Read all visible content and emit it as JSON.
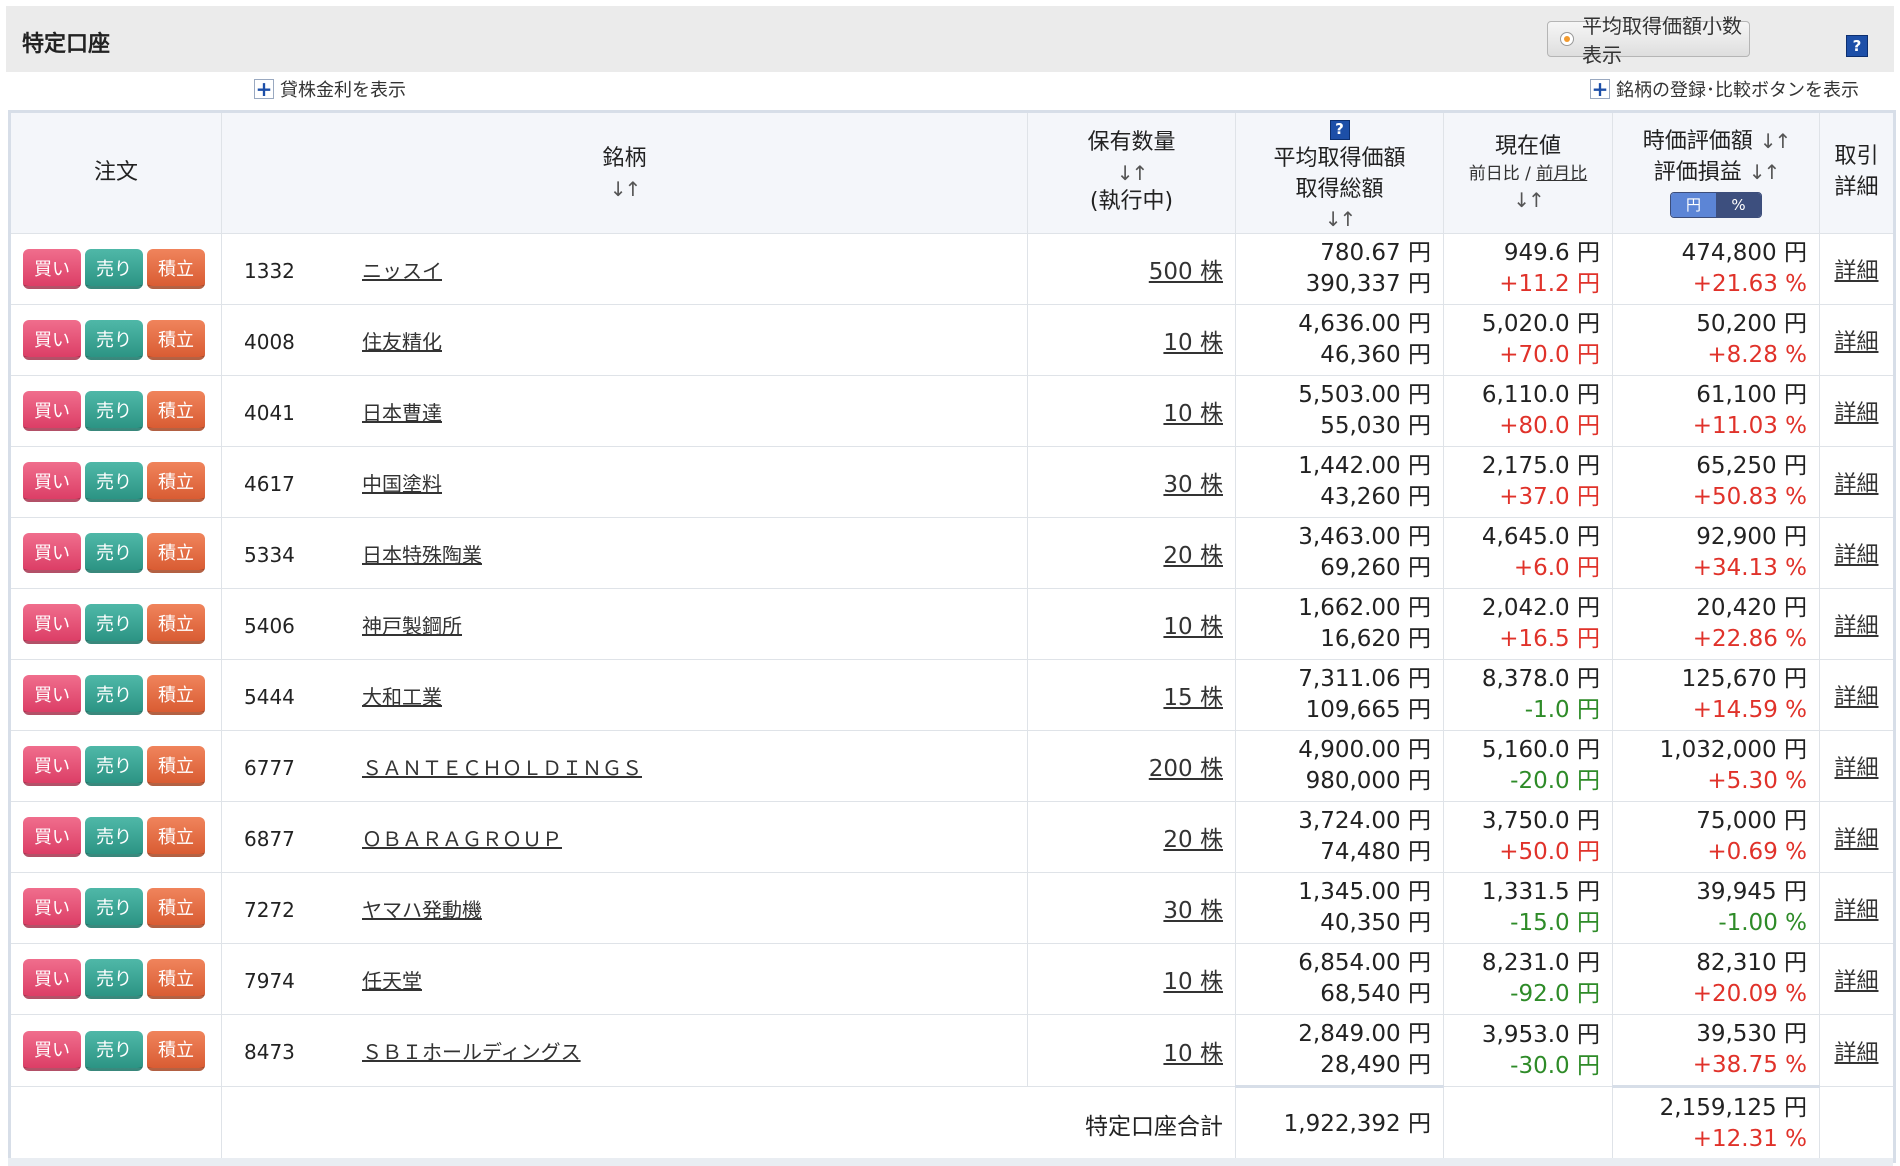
{
  "header": {
    "title": "特定口座",
    "decimal_toggle_label": "平均取得価額小数表示",
    "help_icon_text": "?"
  },
  "links": {
    "lending_rate": "貸株金利を表示",
    "register_compare": "銘柄の登録･比較ボタンを表示"
  },
  "table": {
    "columns": {
      "order": "注文",
      "stock": "銘柄",
      "sort": "↓↑",
      "quantity_line1": "保有数量",
      "quantity_line2": "(執行中)",
      "avg_line1": "平均取得価額",
      "avg_line2": "取得総額",
      "price_line1": "現在値",
      "price_prev_day": "前日比",
      "price_sep": " / ",
      "price_prev_month": "前月比",
      "value_line1": "時価評価額",
      "value_line2": "評価損益",
      "unit_yen": "円",
      "unit_pct": "%",
      "detail_line1": "取引",
      "detail_line2": "詳細"
    },
    "buttons": {
      "buy": "買い",
      "sell": "売り",
      "tsumitate": "積立"
    },
    "detail_label": "詳細",
    "rows": [
      {
        "code": "1332",
        "name": "ニッスイ",
        "qty": "500 株",
        "avg_price": "780.67 円",
        "total_cost": "390,337 円",
        "price": "949.6 円",
        "change": "+11.2 円",
        "change_sign": "pos",
        "value": "474,800 円",
        "pl": "+21.63 %",
        "pl_sign": "pos"
      },
      {
        "code": "4008",
        "name": "住友精化",
        "qty": "10 株",
        "avg_price": "4,636.00 円",
        "total_cost": "46,360 円",
        "price": "5,020.0 円",
        "change": "+70.0 円",
        "change_sign": "pos",
        "value": "50,200 円",
        "pl": "+8.28 %",
        "pl_sign": "pos"
      },
      {
        "code": "4041",
        "name": "日本曹達",
        "qty": "10 株",
        "avg_price": "5,503.00 円",
        "total_cost": "55,030 円",
        "price": "6,110.0 円",
        "change": "+80.0 円",
        "change_sign": "pos",
        "value": "61,100 円",
        "pl": "+11.03 %",
        "pl_sign": "pos"
      },
      {
        "code": "4617",
        "name": "中国塗料",
        "qty": "30 株",
        "avg_price": "1,442.00 円",
        "total_cost": "43,260 円",
        "price": "2,175.0 円",
        "change": "+37.0 円",
        "change_sign": "pos",
        "value": "65,250 円",
        "pl": "+50.83 %",
        "pl_sign": "pos"
      },
      {
        "code": "5334",
        "name": "日本特殊陶業",
        "qty": "20 株",
        "avg_price": "3,463.00 円",
        "total_cost": "69,260 円",
        "price": "4,645.0 円",
        "change": "+6.0 円",
        "change_sign": "pos",
        "value": "92,900 円",
        "pl": "+34.13 %",
        "pl_sign": "pos"
      },
      {
        "code": "5406",
        "name": "神戸製鋼所",
        "qty": "10 株",
        "avg_price": "1,662.00 円",
        "total_cost": "16,620 円",
        "price": "2,042.0 円",
        "change": "+16.5 円",
        "change_sign": "pos",
        "value": "20,420 円",
        "pl": "+22.86 %",
        "pl_sign": "pos"
      },
      {
        "code": "5444",
        "name": "大和工業",
        "qty": "15 株",
        "avg_price": "7,311.06 円",
        "total_cost": "109,665 円",
        "price": "8,378.0 円",
        "change": "-1.0 円",
        "change_sign": "neg",
        "value": "125,670 円",
        "pl": "+14.59 %",
        "pl_sign": "pos"
      },
      {
        "code": "6777",
        "name": "ＳＡＮＴＥＣＨＯＬＤＩＮＧＳ",
        "qty": "200 株",
        "avg_price": "4,900.00 円",
        "total_cost": "980,000 円",
        "price": "5,160.0 円",
        "change": "-20.0 円",
        "change_sign": "neg",
        "value": "1,032,000 円",
        "pl": "+5.30 %",
        "pl_sign": "pos"
      },
      {
        "code": "6877",
        "name": "ＯＢＡＲＡＧＲＯＵＰ",
        "qty": "20 株",
        "avg_price": "3,724.00 円",
        "total_cost": "74,480 円",
        "price": "3,750.0 円",
        "change": "+50.0 円",
        "change_sign": "pos",
        "value": "75,000 円",
        "pl": "+0.69 %",
        "pl_sign": "pos"
      },
      {
        "code": "7272",
        "name": "ヤマハ発動機",
        "qty": "30 株",
        "avg_price": "1,345.00 円",
        "total_cost": "40,350 円",
        "price": "1,331.5 円",
        "change": "-15.0 円",
        "change_sign": "neg",
        "value": "39,945 円",
        "pl": "-1.00 %",
        "pl_sign": "neg"
      },
      {
        "code": "7974",
        "name": "任天堂",
        "qty": "10 株",
        "avg_price": "6,854.00 円",
        "total_cost": "68,540 円",
        "price": "8,231.0 円",
        "change": "-92.0 円",
        "change_sign": "neg",
        "value": "82,310 円",
        "pl": "+20.09 %",
        "pl_sign": "pos"
      },
      {
        "code": "8473",
        "name": "ＳＢＩホールディングス",
        "qty": "10 株",
        "avg_price": "2,849.00 円",
        "total_cost": "28,490 円",
        "price": "3,953.0 円",
        "change": "-30.0 円",
        "change_sign": "neg",
        "value": "39,530 円",
        "pl": "+38.75 %",
        "pl_sign": "pos"
      }
    ],
    "total": {
      "label": "特定口座合計",
      "total_cost": "1,922,392 円",
      "value": "2,159,125 円",
      "pl": "+12.31 %"
    }
  },
  "colors": {
    "positive": "#e0322a",
    "negative": "#2e8b28",
    "buy_button": "#dc3e66",
    "sell_button": "#2c9484",
    "tsumitate_button": "#d95c33",
    "help_icon": "#1d4fa8"
  }
}
